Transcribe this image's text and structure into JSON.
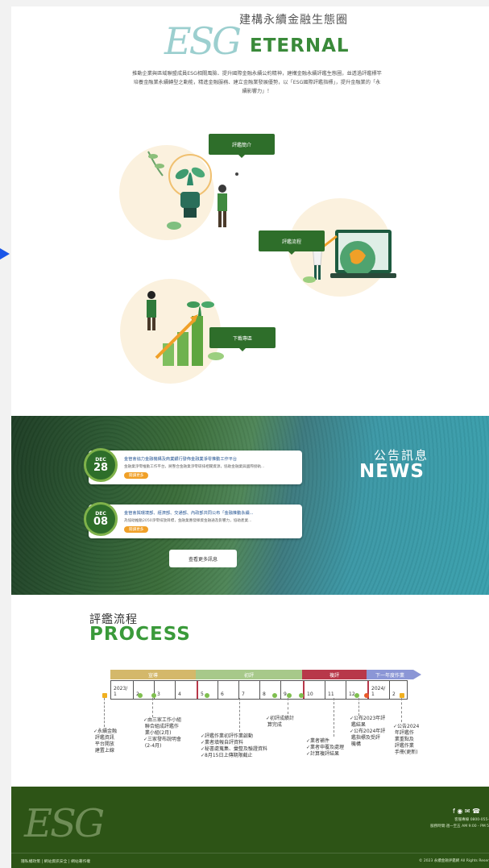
{
  "header": {
    "logo_text": "ESG",
    "brand_cn": "建構永續金融生態圈",
    "brand_en": "ETERNAL",
    "intro": "推動企業與區域聯盟成員ESG相關風險、提升國際金融永續公約精神，建構金融永續評鑑生態圈，並透過評鑑標竿培養金融業永續轉型之動能，精進金融服務、建立金融業發展優勢，以「ESG國際評鑑指標」，提升金融業的「永續影響力」！"
  },
  "features": {
    "intro_btn": "評鑑簡介",
    "process_btn": "評鑑流程",
    "download_btn": "下載專區"
  },
  "news": {
    "title_cn": "公告訊息",
    "title_en": "NEWS",
    "items": [
      {
        "month": "DEC",
        "day": "28",
        "headline": "金管會協力金融機構及商業銀行發佈金融業淨零推動工作平台",
        "summary": "金融業淨零推動工作平台，將整合金融業淨零碳排相關資源，協助金融業與國際接軌...",
        "more": "閱讀更多"
      },
      {
        "month": "DEC",
        "day": "08",
        "headline": "金管會與環境部、經濟部、交通部、內政部共同公布「金融推動永續...",
        "summary": "為協助推動2050淨零排放目標，金融業應發揮資金融通及影響力，協助產業...",
        "more": "閱讀更多"
      }
    ],
    "view_more": "查看更多訊息"
  },
  "process": {
    "title_cn": "評鑑流程",
    "title_en": "PROCESS",
    "phases": [
      "宣導",
      "初評",
      "複評",
      "下一年度作業"
    ],
    "year_start": "2023/",
    "year_next": "2024/",
    "months": [
      "1",
      "2",
      "3",
      "4",
      "5",
      "6",
      "7",
      "8",
      "9",
      "10",
      "11",
      "12",
      "1",
      "2"
    ],
    "notes": [
      "✓永續金融\n 評鑑資訊\n 平台開放\n 建置上線",
      "✓由三家工作小組\n 聯合組成評鑑作\n 業小組(2月)\n✓三家發布說明會\n (2-4月)",
      "✓評鑑作業初評作業啟動\n✓業者填報自評資料\n✓秘書處蒐集、彙整及驗證資料\n✓8月15日上傳期限截止",
      "✓初評成績計\n 算完成",
      "✓業者補件\n✓業者申覆及處理\n✓計算複評結果",
      "✓公布2023年評\n 鑑結果\n✓公布2024年評\n 鑑指標及受評\n 機構",
      "✓公告2024\n 年評鑑作\n 業重點及\n 評鑑作業\n 手冊(更新)"
    ]
  },
  "footer": {
    "logo_text": "ESG",
    "icons": [
      "facebook-icon",
      "line-icon",
      "mail-icon",
      "phone-icon"
    ],
    "icon_glyphs": "f ◉ ✉ ☎",
    "phone": "客服專線 0800-055-",
    "hours": "服務時間:週一至五 AM 9:00 - PM 5",
    "links": "隱私權政策 | 網站資訊安全 | 網站著作權",
    "copyright": "© 2023 永續金融評鑑網 All Rights Reser"
  },
  "colors": {
    "brand_green": "#2e6e2a",
    "title_green": "#3a9a3a",
    "phase_colors": [
      "#d4b86a",
      "#a7c98a",
      "#b8384a",
      "#8b96d6"
    ]
  }
}
